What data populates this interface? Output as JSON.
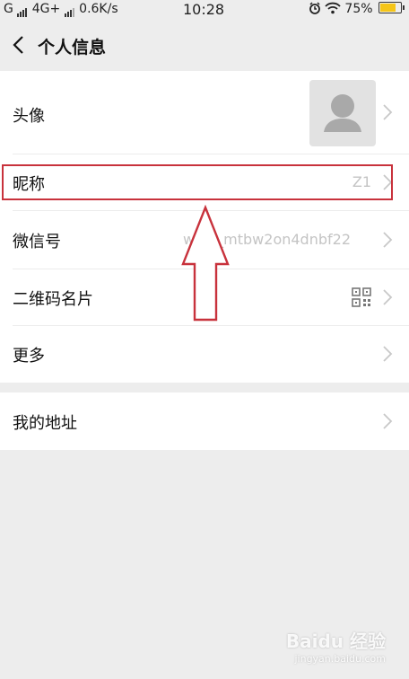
{
  "status_bar": {
    "carrier_left": "G",
    "network": "4G+",
    "speed": "0.6K/s",
    "time": "10:28",
    "battery": "75%",
    "battery_level": 0.75,
    "icons": [
      "alarm-icon",
      "wifi-icon",
      "battery-icon"
    ]
  },
  "header": {
    "title": "个人信息",
    "back_icon": "chevron-left-icon"
  },
  "profile_rows": [
    {
      "label": "头像"
    },
    {
      "label": "昵称",
      "value": "Z1"
    },
    {
      "label": "微信号",
      "value": "wxid_mtbw2on4dnbf22"
    },
    {
      "label": "二维码名片",
      "icon": "qr-code-icon"
    },
    {
      "label": "更多"
    }
  ],
  "address_row": {
    "label": "我的地址"
  },
  "annotation": {
    "color": "#c8323c"
  },
  "watermark": {
    "text": "Baidu 经验",
    "sub": "jingyan.baidu.com"
  }
}
